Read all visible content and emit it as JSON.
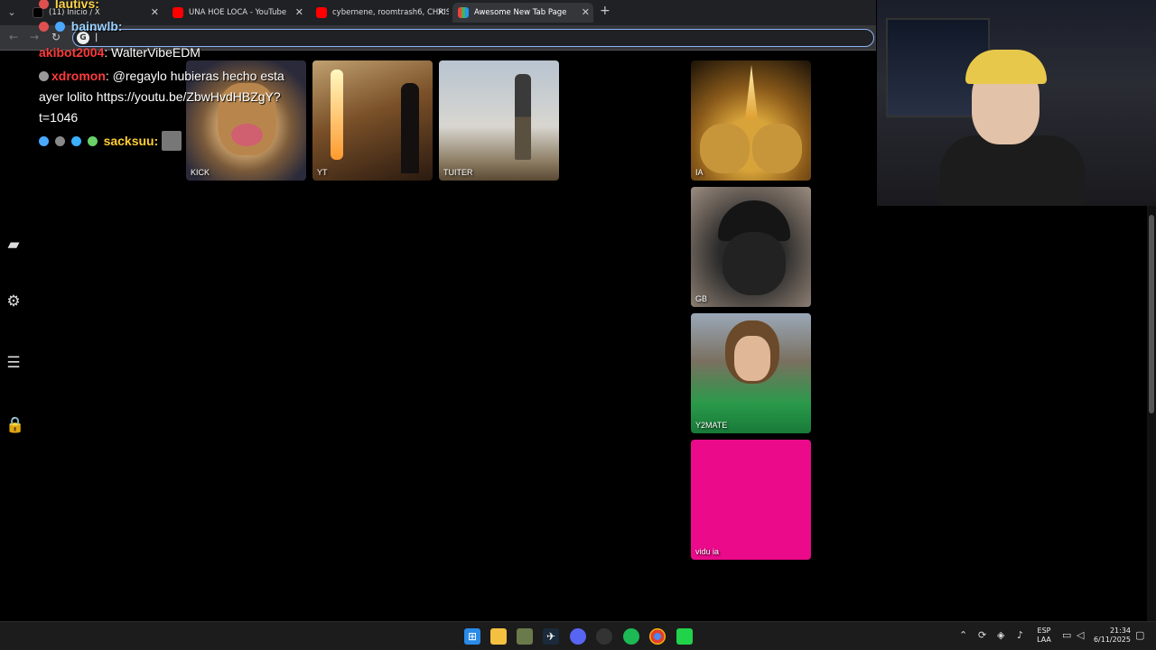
{
  "browser": {
    "tabs": [
      {
        "label": "(11) Inicio / X",
        "favicon_color": "#000000"
      },
      {
        "label": "UNA HOE LOCA - YouTube",
        "favicon_color": "#ff0000"
      },
      {
        "label": "cybernene, roomtrash6, CHRIS",
        "favicon_color": "#ff0000"
      },
      {
        "label": "Awesome New Tab Page",
        "favicon_color": "#4caf50"
      }
    ],
    "omnibox": {
      "engine_icon": "G",
      "value": "|"
    }
  },
  "chat": [
    {
      "user": "lautivs:",
      "text": "",
      "color": "#ffd54a"
    },
    {
      "user": "bainwlb:",
      "text": "",
      "color": "#9ad0ff"
    },
    {
      "user": "akibot2004",
      "text": ": WalterVibeEDM",
      "color": "#ff3b3b"
    },
    {
      "user": "xdromon",
      "text": ": @regaylo hubieras hecho esta ayer lolito https://youtu.be/ZbwHvdHBZgY?t=1046",
      "color": "#ff3b3b"
    },
    {
      "user": "sacksuu:",
      "text": "",
      "color": "#ffcc33"
    }
  ],
  "tiles": {
    "kick": "KICK",
    "yt": "YT",
    "tuiter": "TUITER",
    "ia": "IA",
    "gb": "GB",
    "y2mate": "Y2MATE",
    "vidu": "vidu ia"
  },
  "taskbar": {
    "lang_top": "ESP",
    "lang_bottom": "LAA",
    "time": "21:34",
    "date": "6/11/2025"
  }
}
